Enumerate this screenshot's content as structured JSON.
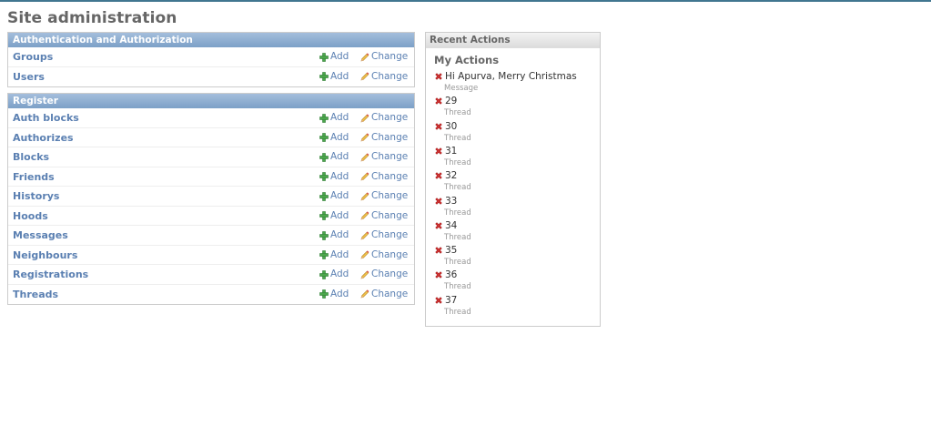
{
  "page": {
    "title": "Site administration"
  },
  "labels": {
    "add": "Add",
    "change": "Change"
  },
  "modules": [
    {
      "caption": "Authentication and Authorization",
      "models": [
        "Groups",
        "Users"
      ]
    },
    {
      "caption": "Register",
      "models": [
        "Auth blocks",
        "Authorizes",
        "Blocks",
        "Friends",
        "Historys",
        "Hoods",
        "Messages",
        "Neighbours",
        "Registrations",
        "Threads"
      ]
    }
  ],
  "recent_actions": {
    "caption": "Recent Actions",
    "subtitle": "My Actions",
    "items": [
      {
        "object": "Hi Apurva, Merry Christmas",
        "type": "Message"
      },
      {
        "object": "29",
        "type": "Thread"
      },
      {
        "object": "30",
        "type": "Thread"
      },
      {
        "object": "31",
        "type": "Thread"
      },
      {
        "object": "32",
        "type": "Thread"
      },
      {
        "object": "33",
        "type": "Thread"
      },
      {
        "object": "34",
        "type": "Thread"
      },
      {
        "object": "35",
        "type": "Thread"
      },
      {
        "object": "36",
        "type": "Thread"
      },
      {
        "object": "37",
        "type": "Thread"
      }
    ]
  },
  "colors": {
    "accent": "#417690",
    "link": "#5b80b2",
    "module_header": "#7ca0c7",
    "delete_icon": "#cc3333",
    "add_icon": "#4ca64c"
  }
}
